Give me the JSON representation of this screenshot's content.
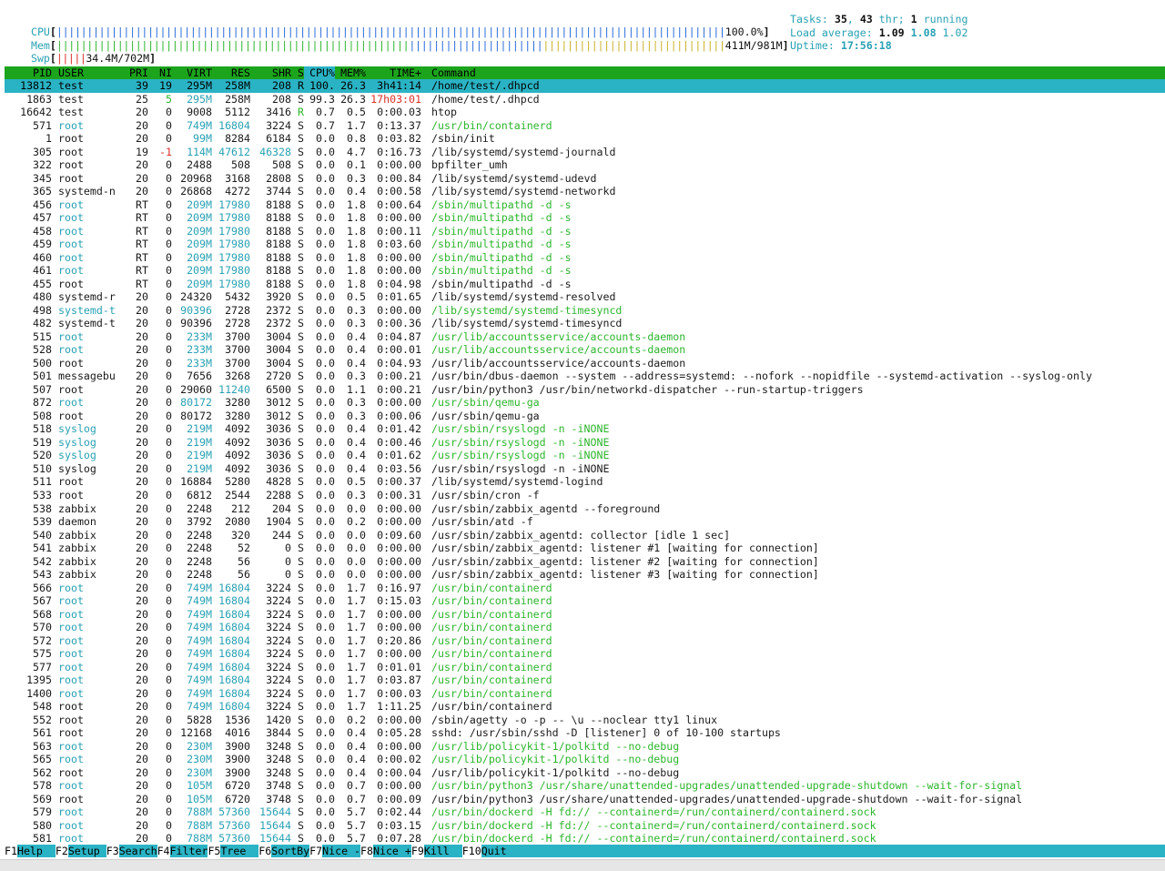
{
  "meters": {
    "cpu": {
      "label": "CPU",
      "value": "100.0%"
    },
    "mem": {
      "label": "Mem",
      "value": "411M/981M"
    },
    "swp": {
      "label": "Swp",
      "value": "34.4M/702M"
    }
  },
  "info": {
    "tasks_label": "Tasks: ",
    "tasks": "35",
    "thr": "43",
    "thr_label": " thr; ",
    "running": "1",
    "running_label": " running",
    "load_label": "Load average: ",
    "load1": "1.09",
    "load5": "1.08",
    "load15": "1.02",
    "uptime_label": "Uptime: ",
    "uptime": "17:56:18"
  },
  "columns": {
    "pid": "PID",
    "user": "USER",
    "pri": "PRI",
    "ni": "NI",
    "virt": "VIRT",
    "res": "RES",
    "shr": "SHR",
    "s": "S",
    "cpu": "CPU%",
    "mem": "MEM%",
    "time": "TIME+",
    "cmd": "Command"
  },
  "colors": {
    "header_bg": "#1ca41c",
    "selected_bg": "#2ab3c4",
    "accent_cyan": "#2aa1b3",
    "thread_green": "#2db52d",
    "alert_red": "#d9302a"
  },
  "processes": [
    {
      "pid": "13812",
      "user": "test",
      "pri": "39",
      "ni": "19",
      "virt": "295M",
      "res": "258M",
      "shr": "208",
      "s": "R",
      "cpu": "100.",
      "mem": "26.3",
      "time": "3h41:14",
      "cmd": "/home/test/.dhpcd",
      "kind": "sel"
    },
    {
      "pid": "1863",
      "user": "test",
      "pri": "25",
      "ni": "5",
      "virt": "295M",
      "res": "258M",
      "shr": "208",
      "s": "S",
      "cpu": "99.3",
      "mem": "26.3",
      "time": "17h03:01",
      "cmd": "/home/test/.dhpcd",
      "kind": "normal"
    },
    {
      "pid": "16642",
      "user": "test",
      "pri": "20",
      "ni": "0",
      "virt": "9008",
      "res": "5112",
      "shr": "3416",
      "s": "R",
      "cpu": "0.7",
      "mem": "0.5",
      "time": "0:00.03",
      "cmd": "htop",
      "kind": "normal"
    },
    {
      "pid": "571",
      "user": "root",
      "pri": "20",
      "ni": "0",
      "virt": "749M",
      "res": "16804",
      "shr": "3224",
      "s": "S",
      "cpu": "0.7",
      "mem": "1.7",
      "time": "0:13.37",
      "cmd": "/usr/bin/containerd",
      "kind": "thread"
    },
    {
      "pid": "1",
      "user": "root",
      "pri": "20",
      "ni": "0",
      "virt": "99M",
      "res": "8284",
      "shr": "6184",
      "s": "S",
      "cpu": "0.0",
      "mem": "0.8",
      "time": "0:03.82",
      "cmd": "/sbin/init",
      "kind": "normal"
    },
    {
      "pid": "305",
      "user": "root",
      "pri": "19",
      "ni": "-1",
      "virt": "114M",
      "res": "47612",
      "shr": "46328",
      "s": "S",
      "cpu": "0.0",
      "mem": "4.7",
      "time": "0:16.73",
      "cmd": "/lib/systemd/systemd-journald",
      "kind": "normal"
    },
    {
      "pid": "322",
      "user": "root",
      "pri": "20",
      "ni": "0",
      "virt": "2488",
      "res": "508",
      "shr": "508",
      "s": "S",
      "cpu": "0.0",
      "mem": "0.1",
      "time": "0:00.00",
      "cmd": "bpfilter_umh",
      "kind": "normal"
    },
    {
      "pid": "345",
      "user": "root",
      "pri": "20",
      "ni": "0",
      "virt": "20968",
      "res": "3168",
      "shr": "2808",
      "s": "S",
      "cpu": "0.0",
      "mem": "0.3",
      "time": "0:00.84",
      "cmd": "/lib/systemd/systemd-udevd",
      "kind": "normal"
    },
    {
      "pid": "365",
      "user": "systemd-n",
      "pri": "20",
      "ni": "0",
      "virt": "26868",
      "res": "4272",
      "shr": "3744",
      "s": "S",
      "cpu": "0.0",
      "mem": "0.4",
      "time": "0:00.58",
      "cmd": "/lib/systemd/systemd-networkd",
      "kind": "normal"
    },
    {
      "pid": "456",
      "user": "root",
      "pri": "RT",
      "ni": "0",
      "virt": "209M",
      "res": "17980",
      "shr": "8188",
      "s": "S",
      "cpu": "0.0",
      "mem": "1.8",
      "time": "0:00.64",
      "cmd": "/sbin/multipathd -d -s",
      "kind": "thread"
    },
    {
      "pid": "457",
      "user": "root",
      "pri": "RT",
      "ni": "0",
      "virt": "209M",
      "res": "17980",
      "shr": "8188",
      "s": "S",
      "cpu": "0.0",
      "mem": "1.8",
      "time": "0:00.00",
      "cmd": "/sbin/multipathd -d -s",
      "kind": "thread"
    },
    {
      "pid": "458",
      "user": "root",
      "pri": "RT",
      "ni": "0",
      "virt": "209M",
      "res": "17980",
      "shr": "8188",
      "s": "S",
      "cpu": "0.0",
      "mem": "1.8",
      "time": "0:00.11",
      "cmd": "/sbin/multipathd -d -s",
      "kind": "thread"
    },
    {
      "pid": "459",
      "user": "root",
      "pri": "RT",
      "ni": "0",
      "virt": "209M",
      "res": "17980",
      "shr": "8188",
      "s": "S",
      "cpu": "0.0",
      "mem": "1.8",
      "time": "0:03.60",
      "cmd": "/sbin/multipathd -d -s",
      "kind": "thread"
    },
    {
      "pid": "460",
      "user": "root",
      "pri": "RT",
      "ni": "0",
      "virt": "209M",
      "res": "17980",
      "shr": "8188",
      "s": "S",
      "cpu": "0.0",
      "mem": "1.8",
      "time": "0:00.00",
      "cmd": "/sbin/multipathd -d -s",
      "kind": "thread"
    },
    {
      "pid": "461",
      "user": "root",
      "pri": "RT",
      "ni": "0",
      "virt": "209M",
      "res": "17980",
      "shr": "8188",
      "s": "S",
      "cpu": "0.0",
      "mem": "1.8",
      "time": "0:00.00",
      "cmd": "/sbin/multipathd -d -s",
      "kind": "thread"
    },
    {
      "pid": "455",
      "user": "root",
      "pri": "RT",
      "ni": "0",
      "virt": "209M",
      "res": "17980",
      "shr": "8188",
      "s": "S",
      "cpu": "0.0",
      "mem": "1.8",
      "time": "0:04.98",
      "cmd": "/sbin/multipathd -d -s",
      "kind": "normal"
    },
    {
      "pid": "480",
      "user": "systemd-r",
      "pri": "20",
      "ni": "0",
      "virt": "24320",
      "res": "5432",
      "shr": "3920",
      "s": "S",
      "cpu": "0.0",
      "mem": "0.5",
      "time": "0:01.65",
      "cmd": "/lib/systemd/systemd-resolved",
      "kind": "normal"
    },
    {
      "pid": "498",
      "user": "systemd-t",
      "pri": "20",
      "ni": "0",
      "virt": "90396",
      "res": "2728",
      "shr": "2372",
      "s": "S",
      "cpu": "0.0",
      "mem": "0.3",
      "time": "0:00.00",
      "cmd": "/lib/systemd/systemd-timesyncd",
      "kind": "thread"
    },
    {
      "pid": "482",
      "user": "systemd-t",
      "pri": "20",
      "ni": "0",
      "virt": "90396",
      "res": "2728",
      "shr": "2372",
      "s": "S",
      "cpu": "0.0",
      "mem": "0.3",
      "time": "0:00.36",
      "cmd": "/lib/systemd/systemd-timesyncd",
      "kind": "normal"
    },
    {
      "pid": "515",
      "user": "root",
      "pri": "20",
      "ni": "0",
      "virt": "233M",
      "res": "3700",
      "shr": "3004",
      "s": "S",
      "cpu": "0.0",
      "mem": "0.4",
      "time": "0:04.87",
      "cmd": "/usr/lib/accountsservice/accounts-daemon",
      "kind": "thread"
    },
    {
      "pid": "528",
      "user": "root",
      "pri": "20",
      "ni": "0",
      "virt": "233M",
      "res": "3700",
      "shr": "3004",
      "s": "S",
      "cpu": "0.0",
      "mem": "0.4",
      "time": "0:00.01",
      "cmd": "/usr/lib/accountsservice/accounts-daemon",
      "kind": "thread"
    },
    {
      "pid": "500",
      "user": "root",
      "pri": "20",
      "ni": "0",
      "virt": "233M",
      "res": "3700",
      "shr": "3004",
      "s": "S",
      "cpu": "0.0",
      "mem": "0.4",
      "time": "0:04.93",
      "cmd": "/usr/lib/accountsservice/accounts-daemon",
      "kind": "normal"
    },
    {
      "pid": "501",
      "user": "messagebu",
      "pri": "20",
      "ni": "0",
      "virt": "7656",
      "res": "3268",
      "shr": "2720",
      "s": "S",
      "cpu": "0.0",
      "mem": "0.3",
      "time": "0:00.21",
      "cmd": "/usr/bin/dbus-daemon --system --address=systemd: --nofork --nopidfile --systemd-activation --syslog-only",
      "kind": "normal"
    },
    {
      "pid": "507",
      "user": "root",
      "pri": "20",
      "ni": "0",
      "virt": "29060",
      "res": "11240",
      "shr": "6500",
      "s": "S",
      "cpu": "0.0",
      "mem": "1.1",
      "time": "0:00.21",
      "cmd": "/usr/bin/python3 /usr/bin/networkd-dispatcher --run-startup-triggers",
      "kind": "normal"
    },
    {
      "pid": "872",
      "user": "root",
      "pri": "20",
      "ni": "0",
      "virt": "80172",
      "res": "3280",
      "shr": "3012",
      "s": "S",
      "cpu": "0.0",
      "mem": "0.3",
      "time": "0:00.00",
      "cmd": "/usr/sbin/qemu-ga",
      "kind": "thread"
    },
    {
      "pid": "508",
      "user": "root",
      "pri": "20",
      "ni": "0",
      "virt": "80172",
      "res": "3280",
      "shr": "3012",
      "s": "S",
      "cpu": "0.0",
      "mem": "0.3",
      "time": "0:00.06",
      "cmd": "/usr/sbin/qemu-ga",
      "kind": "normal"
    },
    {
      "pid": "518",
      "user": "syslog",
      "pri": "20",
      "ni": "0",
      "virt": "219M",
      "res": "4092",
      "shr": "3036",
      "s": "S",
      "cpu": "0.0",
      "mem": "0.4",
      "time": "0:01.42",
      "cmd": "/usr/sbin/rsyslogd -n -iNONE",
      "kind": "thread"
    },
    {
      "pid": "519",
      "user": "syslog",
      "pri": "20",
      "ni": "0",
      "virt": "219M",
      "res": "4092",
      "shr": "3036",
      "s": "S",
      "cpu": "0.0",
      "mem": "0.4",
      "time": "0:00.46",
      "cmd": "/usr/sbin/rsyslogd -n -iNONE",
      "kind": "thread"
    },
    {
      "pid": "520",
      "user": "syslog",
      "pri": "20",
      "ni": "0",
      "virt": "219M",
      "res": "4092",
      "shr": "3036",
      "s": "S",
      "cpu": "0.0",
      "mem": "0.4",
      "time": "0:01.62",
      "cmd": "/usr/sbin/rsyslogd -n -iNONE",
      "kind": "thread"
    },
    {
      "pid": "510",
      "user": "syslog",
      "pri": "20",
      "ni": "0",
      "virt": "219M",
      "res": "4092",
      "shr": "3036",
      "s": "S",
      "cpu": "0.0",
      "mem": "0.4",
      "time": "0:03.56",
      "cmd": "/usr/sbin/rsyslogd -n -iNONE",
      "kind": "normal"
    },
    {
      "pid": "511",
      "user": "root",
      "pri": "20",
      "ni": "0",
      "virt": "16884",
      "res": "5280",
      "shr": "4828",
      "s": "S",
      "cpu": "0.0",
      "mem": "0.5",
      "time": "0:00.37",
      "cmd": "/lib/systemd/systemd-logind",
      "kind": "normal"
    },
    {
      "pid": "533",
      "user": "root",
      "pri": "20",
      "ni": "0",
      "virt": "6812",
      "res": "2544",
      "shr": "2288",
      "s": "S",
      "cpu": "0.0",
      "mem": "0.3",
      "time": "0:00.31",
      "cmd": "/usr/sbin/cron -f",
      "kind": "normal"
    },
    {
      "pid": "538",
      "user": "zabbix",
      "pri": "20",
      "ni": "0",
      "virt": "2248",
      "res": "212",
      "shr": "204",
      "s": "S",
      "cpu": "0.0",
      "mem": "0.0",
      "time": "0:00.00",
      "cmd": "/usr/sbin/zabbix_agentd --foreground",
      "kind": "normal"
    },
    {
      "pid": "539",
      "user": "daemon",
      "pri": "20",
      "ni": "0",
      "virt": "3792",
      "res": "2080",
      "shr": "1904",
      "s": "S",
      "cpu": "0.0",
      "mem": "0.2",
      "time": "0:00.00",
      "cmd": "/usr/sbin/atd -f",
      "kind": "normal"
    },
    {
      "pid": "540",
      "user": "zabbix",
      "pri": "20",
      "ni": "0",
      "virt": "2248",
      "res": "320",
      "shr": "244",
      "s": "S",
      "cpu": "0.0",
      "mem": "0.0",
      "time": "0:09.60",
      "cmd": "/usr/sbin/zabbix_agentd: collector [idle 1 sec]",
      "kind": "normal"
    },
    {
      "pid": "541",
      "user": "zabbix",
      "pri": "20",
      "ni": "0",
      "virt": "2248",
      "res": "52",
      "shr": "0",
      "s": "S",
      "cpu": "0.0",
      "mem": "0.0",
      "time": "0:00.00",
      "cmd": "/usr/sbin/zabbix_agentd: listener #1 [waiting for connection]",
      "kind": "normal"
    },
    {
      "pid": "542",
      "user": "zabbix",
      "pri": "20",
      "ni": "0",
      "virt": "2248",
      "res": "56",
      "shr": "0",
      "s": "S",
      "cpu": "0.0",
      "mem": "0.0",
      "time": "0:00.00",
      "cmd": "/usr/sbin/zabbix_agentd: listener #2 [waiting for connection]",
      "kind": "normal"
    },
    {
      "pid": "543",
      "user": "zabbix",
      "pri": "20",
      "ni": "0",
      "virt": "2248",
      "res": "56",
      "shr": "0",
      "s": "S",
      "cpu": "0.0",
      "mem": "0.0",
      "time": "0:00.00",
      "cmd": "/usr/sbin/zabbix_agentd: listener #3 [waiting for connection]",
      "kind": "normal"
    },
    {
      "pid": "566",
      "user": "root",
      "pri": "20",
      "ni": "0",
      "virt": "749M",
      "res": "16804",
      "shr": "3224",
      "s": "S",
      "cpu": "0.0",
      "mem": "1.7",
      "time": "0:16.97",
      "cmd": "/usr/bin/containerd",
      "kind": "thread"
    },
    {
      "pid": "567",
      "user": "root",
      "pri": "20",
      "ni": "0",
      "virt": "749M",
      "res": "16804",
      "shr": "3224",
      "s": "S",
      "cpu": "0.0",
      "mem": "1.7",
      "time": "0:15.03",
      "cmd": "/usr/bin/containerd",
      "kind": "thread"
    },
    {
      "pid": "568",
      "user": "root",
      "pri": "20",
      "ni": "0",
      "virt": "749M",
      "res": "16804",
      "shr": "3224",
      "s": "S",
      "cpu": "0.0",
      "mem": "1.7",
      "time": "0:00.00",
      "cmd": "/usr/bin/containerd",
      "kind": "thread"
    },
    {
      "pid": "570",
      "user": "root",
      "pri": "20",
      "ni": "0",
      "virt": "749M",
      "res": "16804",
      "shr": "3224",
      "s": "S",
      "cpu": "0.0",
      "mem": "1.7",
      "time": "0:00.00",
      "cmd": "/usr/bin/containerd",
      "kind": "thread"
    },
    {
      "pid": "572",
      "user": "root",
      "pri": "20",
      "ni": "0",
      "virt": "749M",
      "res": "16804",
      "shr": "3224",
      "s": "S",
      "cpu": "0.0",
      "mem": "1.7",
      "time": "0:20.86",
      "cmd": "/usr/bin/containerd",
      "kind": "thread"
    },
    {
      "pid": "575",
      "user": "root",
      "pri": "20",
      "ni": "0",
      "virt": "749M",
      "res": "16804",
      "shr": "3224",
      "s": "S",
      "cpu": "0.0",
      "mem": "1.7",
      "time": "0:00.00",
      "cmd": "/usr/bin/containerd",
      "kind": "thread"
    },
    {
      "pid": "577",
      "user": "root",
      "pri": "20",
      "ni": "0",
      "virt": "749M",
      "res": "16804",
      "shr": "3224",
      "s": "S",
      "cpu": "0.0",
      "mem": "1.7",
      "time": "0:01.01",
      "cmd": "/usr/bin/containerd",
      "kind": "thread"
    },
    {
      "pid": "1395",
      "user": "root",
      "pri": "20",
      "ni": "0",
      "virt": "749M",
      "res": "16804",
      "shr": "3224",
      "s": "S",
      "cpu": "0.0",
      "mem": "1.7",
      "time": "0:03.87",
      "cmd": "/usr/bin/containerd",
      "kind": "thread"
    },
    {
      "pid": "1400",
      "user": "root",
      "pri": "20",
      "ni": "0",
      "virt": "749M",
      "res": "16804",
      "shr": "3224",
      "s": "S",
      "cpu": "0.0",
      "mem": "1.7",
      "time": "0:00.03",
      "cmd": "/usr/bin/containerd",
      "kind": "thread"
    },
    {
      "pid": "548",
      "user": "root",
      "pri": "20",
      "ni": "0",
      "virt": "749M",
      "res": "16804",
      "shr": "3224",
      "s": "S",
      "cpu": "0.0",
      "mem": "1.7",
      "time": "1:11.25",
      "cmd": "/usr/bin/containerd",
      "kind": "normal"
    },
    {
      "pid": "552",
      "user": "root",
      "pri": "20",
      "ni": "0",
      "virt": "5828",
      "res": "1536",
      "shr": "1420",
      "s": "S",
      "cpu": "0.0",
      "mem": "0.2",
      "time": "0:00.00",
      "cmd": "/sbin/agetty -o -p -- \\u --noclear tty1 linux",
      "kind": "normal"
    },
    {
      "pid": "561",
      "user": "root",
      "pri": "20",
      "ni": "0",
      "virt": "12168",
      "res": "4016",
      "shr": "3844",
      "s": "S",
      "cpu": "0.0",
      "mem": "0.4",
      "time": "0:05.28",
      "cmd": "sshd: /usr/sbin/sshd -D [listener] 0 of 10-100 startups",
      "kind": "normal"
    },
    {
      "pid": "563",
      "user": "root",
      "pri": "20",
      "ni": "0",
      "virt": "230M",
      "res": "3900",
      "shr": "3248",
      "s": "S",
      "cpu": "0.0",
      "mem": "0.4",
      "time": "0:00.00",
      "cmd": "/usr/lib/policykit-1/polkitd --no-debug",
      "kind": "thread"
    },
    {
      "pid": "565",
      "user": "root",
      "pri": "20",
      "ni": "0",
      "virt": "230M",
      "res": "3900",
      "shr": "3248",
      "s": "S",
      "cpu": "0.0",
      "mem": "0.4",
      "time": "0:00.02",
      "cmd": "/usr/lib/policykit-1/polkitd --no-debug",
      "kind": "thread"
    },
    {
      "pid": "562",
      "user": "root",
      "pri": "20",
      "ni": "0",
      "virt": "230M",
      "res": "3900",
      "shr": "3248",
      "s": "S",
      "cpu": "0.0",
      "mem": "0.4",
      "time": "0:00.04",
      "cmd": "/usr/lib/policykit-1/polkitd --no-debug",
      "kind": "normal"
    },
    {
      "pid": "578",
      "user": "root",
      "pri": "20",
      "ni": "0",
      "virt": "105M",
      "res": "6720",
      "shr": "3748",
      "s": "S",
      "cpu": "0.0",
      "mem": "0.7",
      "time": "0:00.00",
      "cmd": "/usr/bin/python3 /usr/share/unattended-upgrades/unattended-upgrade-shutdown --wait-for-signal",
      "kind": "thread"
    },
    {
      "pid": "569",
      "user": "root",
      "pri": "20",
      "ni": "0",
      "virt": "105M",
      "res": "6720",
      "shr": "3748",
      "s": "S",
      "cpu": "0.0",
      "mem": "0.7",
      "time": "0:00.09",
      "cmd": "/usr/bin/python3 /usr/share/unattended-upgrades/unattended-upgrade-shutdown --wait-for-signal",
      "kind": "normal"
    },
    {
      "pid": "579",
      "user": "root",
      "pri": "20",
      "ni": "0",
      "virt": "788M",
      "res": "57360",
      "shr": "15644",
      "s": "S",
      "cpu": "0.0",
      "mem": "5.7",
      "time": "0:02.44",
      "cmd": "/usr/bin/dockerd -H fd:// --containerd=/run/containerd/containerd.sock",
      "kind": "thread"
    },
    {
      "pid": "580",
      "user": "root",
      "pri": "20",
      "ni": "0",
      "virt": "788M",
      "res": "57360",
      "shr": "15644",
      "s": "S",
      "cpu": "0.0",
      "mem": "5.7",
      "time": "0:03.15",
      "cmd": "/usr/bin/dockerd -H fd:// --containerd=/run/containerd/containerd.sock",
      "kind": "thread"
    },
    {
      "pid": "581",
      "user": "root",
      "pri": "20",
      "ni": "0",
      "virt": "788M",
      "res": "57360",
      "shr": "15644",
      "s": "S",
      "cpu": "0.0",
      "mem": "5.7",
      "time": "0:07.28",
      "cmd": "/usr/bin/dockerd -H fd:// --containerd=/run/containerd/containerd.sock",
      "kind": "thread"
    }
  ],
  "footer": [
    {
      "key": "F1",
      "label": "Help  "
    },
    {
      "key": "F2",
      "label": "Setup "
    },
    {
      "key": "F3",
      "label": "Search"
    },
    {
      "key": "F4",
      "label": "Filter"
    },
    {
      "key": "F5",
      "label": "Tree  "
    },
    {
      "key": "F6",
      "label": "SortBy"
    },
    {
      "key": "F7",
      "label": "Nice -"
    },
    {
      "key": "F8",
      "label": "Nice +"
    },
    {
      "key": "F9",
      "label": "Kill  "
    },
    {
      "key": "F10",
      "label": "Quit"
    }
  ]
}
